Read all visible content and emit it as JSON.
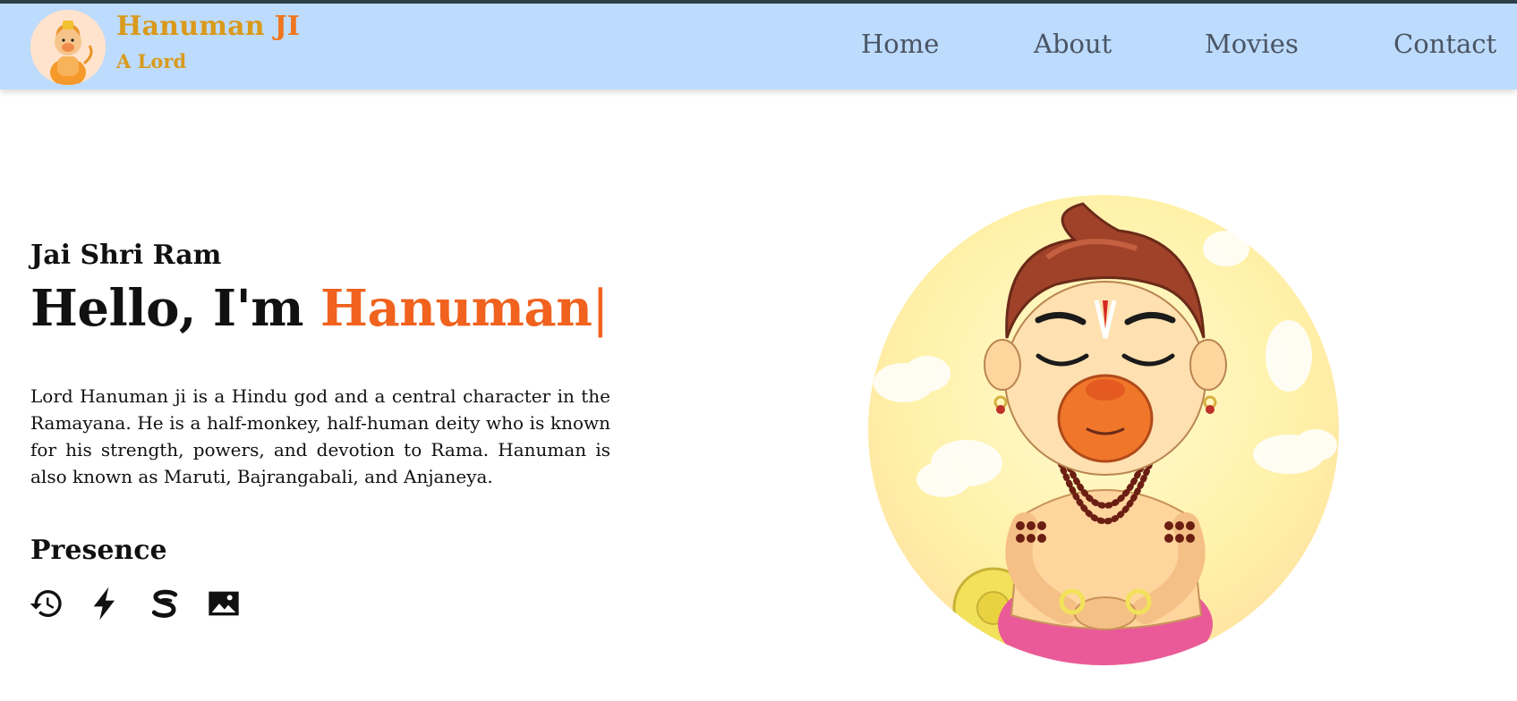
{
  "header": {
    "brand_name": "Hanuman",
    "brand_suffix": "JI",
    "brand_tagline": "A Lord",
    "nav": [
      "Home",
      "About",
      "Movies",
      "Contact"
    ]
  },
  "hero": {
    "greeting": "Jai Shri Ram",
    "hello_prefix": "Hello, I'm",
    "hello_name": "Hanuman",
    "cursor": "|",
    "bio": "Lord Hanuman ji is a Hindu god and a central character in the Ramayana. He is a half-monkey, half-human deity who is known for his strength, powers, and devotion to Rama. Hanuman is also known as Maruti, Bajrangabali, and Anjaneya."
  },
  "presence": {
    "title": "Presence",
    "icons": [
      "history-icon",
      "lightning-bolt-icon",
      "s-logo-icon",
      "image-icon"
    ]
  },
  "colors": {
    "navbar_bg": "#bddbfc",
    "brand": "#d99a1c",
    "accent": "#f0621e",
    "nav_text": "#4a5565"
  }
}
